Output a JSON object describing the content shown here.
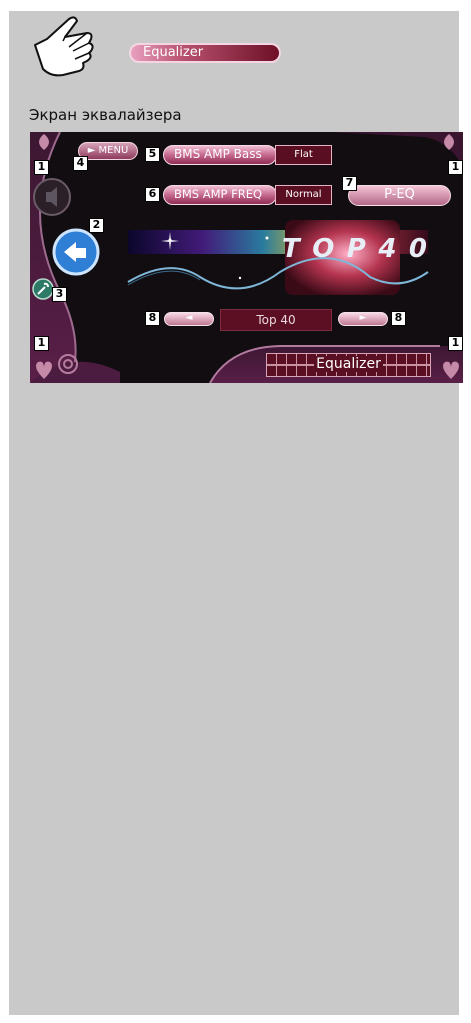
{
  "header": {
    "hand_icon": "pointing-hand-icon",
    "title_pill": "Equalizer",
    "subtitle": "Экран эквалайзера"
  },
  "screen": {
    "menu_label": "► MENU",
    "bms_bass": {
      "label": "BMS AMP Bass",
      "value": "Flat"
    },
    "bms_freq": {
      "label": "BMS AMP FREQ",
      "value": "Normal"
    },
    "peq_label": "P-EQ",
    "logo_text": "TOP40",
    "prev_label": "◄",
    "next_label": "►",
    "preset_name": "Top 40",
    "bottom_label": "Equalizer",
    "callouts": {
      "n1": "1",
      "n2": "2",
      "n3": "3",
      "n4": "4",
      "n5": "5",
      "n6": "6",
      "n7": "7",
      "n8": "8"
    },
    "colors": {
      "accent": "#6e1027",
      "pill_light": "#f0bdd1",
      "panel": "#130f12"
    }
  }
}
